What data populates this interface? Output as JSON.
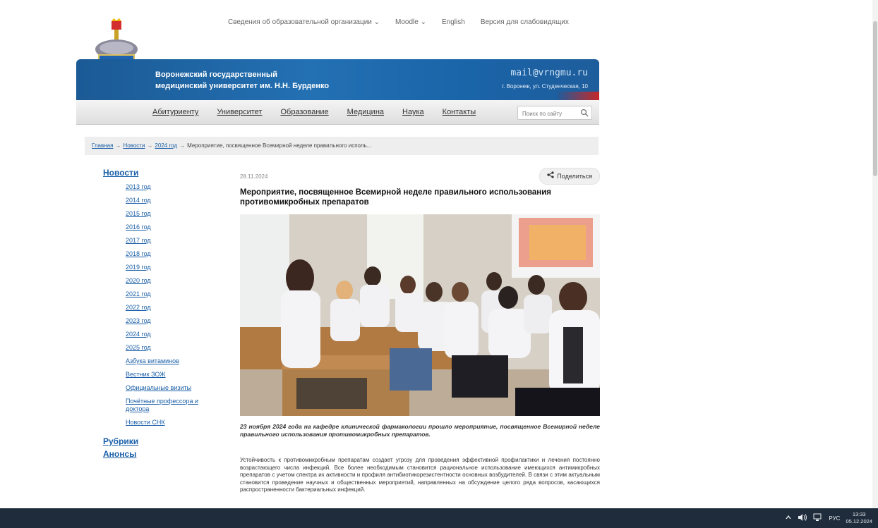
{
  "topnav": {
    "info": "Сведения об образовательной организации ⌄",
    "moodle": "Moodle ⌄",
    "english": "English",
    "low_vision": "Версия для слабовидящих"
  },
  "banner": {
    "title_line1": "Воронежский государственный",
    "title_line2": "медицинский университет им. Н.Н. Бурденко",
    "email": "mail@vrngmu.ru",
    "address": "г. Воронеж, ул. Студенческая, 10"
  },
  "mainnav": {
    "items": [
      "Абитуриенту",
      "Университет",
      "Образование",
      "Медицина",
      "Наука",
      "Контакты"
    ],
    "search_placeholder": "Поиск по сайту"
  },
  "breadcrumb": {
    "home": "Главная",
    "news": "Новости",
    "year": "2024 год",
    "current": "Мероприятие, посвященное Всемирной неделе правильного исполь...",
    "separator": "→"
  },
  "sidebar": {
    "news_heading": "Новости",
    "years": [
      "2013 год",
      "2014 год",
      "2015 год",
      "2016 год",
      "2017 год",
      "2018 год",
      "2019 год",
      "2020 год",
      "2021 год",
      "2022 год",
      "2023 год",
      "2024 год",
      "2025 год"
    ],
    "extra": [
      "Азбука витаминов",
      "Вестник ЗОЖ",
      "Официальные визиты",
      "Почётные профессора и доктора",
      "Новости СНК"
    ],
    "rubrics": "Рубрики",
    "announcements": "Анонсы"
  },
  "article": {
    "date": "28.11.2024",
    "share": "Поделиться",
    "headline": "Мероприятие, посвященное Всемирной неделе правильного использования противомикробных препаратов",
    "caption": "23 ноября 2024 года на кафедре клинической фармакологии прошло мероприятие, посвященное Всемирной неделе правильного использования противомикробных препаратов.",
    "body": "Устойчивость к противомикробным препаратам создает угрозу для проведения эффективной профилактики и лечения постоянно возрастающего числа инфекций. Все более необходимым становится рациональное использование имеющихся антимикробных препаратов с учетом спектра их активности и профиля антибиотикорезистентности основных возбудителей. В связи с этим актуальным становится проведение научных и общественных мероприятий, направленных на обсуждение целого ряда вопросов, касающихся распространенности бактериальных инфекций."
  },
  "taskbar": {
    "lang": "РУС",
    "time": "13:33",
    "date": "05.12.2024"
  }
}
